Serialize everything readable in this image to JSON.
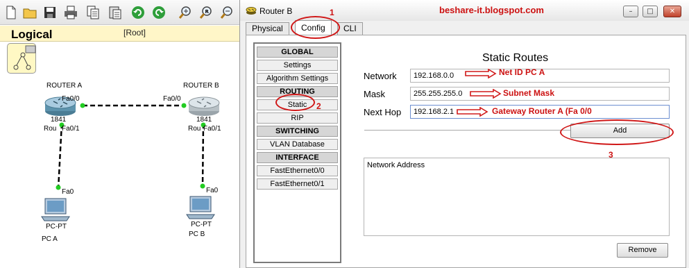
{
  "toolbar": {
    "icons": [
      "new-file-icon",
      "open-folder-icon",
      "save-icon",
      "print-icon",
      "copy-icon",
      "paste-icon",
      "undo-icon",
      "redo-icon",
      "zoom-in-icon",
      "zoom-reset-icon",
      "zoom-out-icon"
    ]
  },
  "workspace": {
    "title": "Logical",
    "root": "[Root]",
    "devices": {
      "router_a": {
        "name": "ROUTER A",
        "model": "1841",
        "short": "Rou",
        "port_top": "Fa0/0",
        "port_bottom": "Fa0/1"
      },
      "router_b": {
        "name": "ROUTER B",
        "model": "1841",
        "short": "Rou",
        "port_top": "Fa0/0",
        "port_bottom": "Fa0/1"
      },
      "pc_a": {
        "type": "PC-PT",
        "name": "PC A",
        "port": "Fa0"
      },
      "pc_b": {
        "type": "PC-PT",
        "name": "PC B",
        "port": "Fa0"
      }
    }
  },
  "window": {
    "title": "Router B",
    "controls": {
      "minimize": "–",
      "maximize": "□",
      "close": "✕"
    },
    "tabs": [
      "Physical",
      "Config",
      "CLI"
    ],
    "active_tab": "Config"
  },
  "nav": {
    "global": "GLOBAL",
    "settings": "Settings",
    "algorithm": "Algorithm Settings",
    "routing": "ROUTING",
    "static": "Static",
    "rip": "RIP",
    "switching": "SWITCHING",
    "vlan": "VLAN Database",
    "interface": "INTERFACE",
    "fa0": "FastEthernet0/0",
    "fa1": "FastEthernet0/1"
  },
  "static_routes": {
    "title": "Static Routes",
    "network_label": "Network",
    "network_value": "192.168.0.0",
    "mask_label": "Mask",
    "mask_value": "255.255.255.0",
    "nexthop_label": "Next Hop",
    "nexthop_value": "192.168.2.1",
    "add_button": "Add",
    "list_header": "Network Address",
    "remove_button": "Remove"
  },
  "annotations": {
    "watermark": "beshare-it.blogspot.com",
    "step1": "1",
    "step2": "2",
    "step3": "3",
    "net_id": "Net ID PC A",
    "subnet": "Subnet Mask",
    "gateway": "Gateway Router A (Fa 0/0"
  },
  "colors": {
    "annotation": "#cc1111",
    "link_up": "#22cc22",
    "logical_bar": "#fff6c8"
  }
}
